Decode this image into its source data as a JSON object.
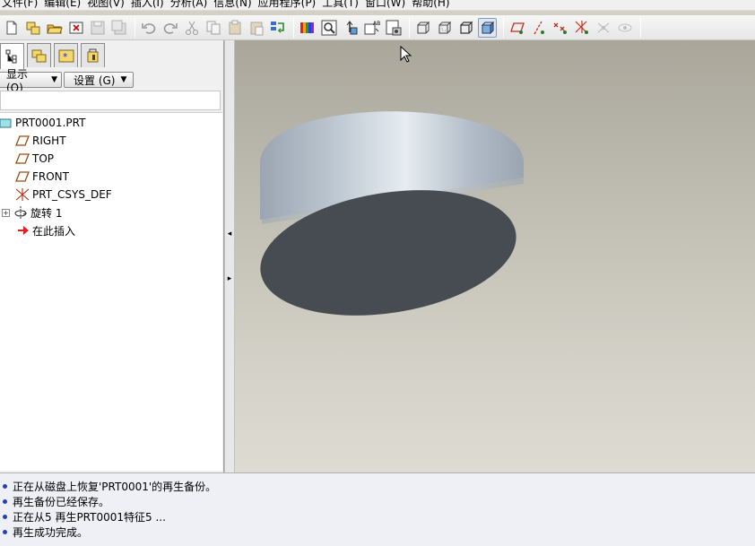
{
  "menubar": {
    "items": [
      "文件(F)",
      "编辑(E)",
      "视图(V)",
      "插入(I)",
      "分析(A)",
      "信息(N)",
      "应用程序(P)",
      "工具(T)",
      "窗口(W)",
      "帮助(H)"
    ]
  },
  "toolbar": {
    "icons": [
      "new-icon",
      "open-session-icon",
      "open-icon",
      "close-window-icon",
      "save-icon",
      "save-copy-icon",
      "undo-icon",
      "redo-icon",
      "cut-icon",
      "copy-icon",
      "paste-icon",
      "paste-special-icon",
      "regenerate-icon",
      "color-appearance-icon",
      "zoom-icon",
      "reorient-icon",
      "saved-views-icon",
      "display-style-icon",
      "wireframe-icon",
      "hidden-line-icon",
      "no-hidden-icon",
      "shading-icon",
      "datum-planes-icon",
      "datum-axes-icon",
      "datum-points-icon",
      "coordinate-systems-icon",
      "spin-center-icon",
      "annotation-icon"
    ],
    "active": "shading-icon"
  },
  "left_panel": {
    "show_button": "显示 (O)",
    "settings_button": "设置 (G)",
    "filter_value": ""
  },
  "model_tree": {
    "root": "PRT0001.PRT",
    "items": [
      {
        "label": "RIGHT",
        "icon": "datum-plane-icon"
      },
      {
        "label": "TOP",
        "icon": "datum-plane-icon"
      },
      {
        "label": "FRONT",
        "icon": "datum-plane-icon"
      },
      {
        "label": "PRT_CSYS_DEF",
        "icon": "coordinate-system-icon"
      },
      {
        "label": "旋转 1",
        "icon": "revolve-feature-icon"
      },
      {
        "label": "在此插入",
        "icon": "insert-here-icon"
      }
    ]
  },
  "messages": [
    "正在从磁盘上恢复'PRT0001'的再生备份。",
    "再生备份已经保存。",
    "正在从5 再生PRT0001特征5 ...",
    "再生成功完成。"
  ],
  "colors": {
    "viewport_top": "#aaa69a",
    "viewport_bottom": "#dedcd2",
    "model_side": "#b9c3ce",
    "model_bottom_face": "#474c52",
    "message_bullet": "#2040c0"
  }
}
